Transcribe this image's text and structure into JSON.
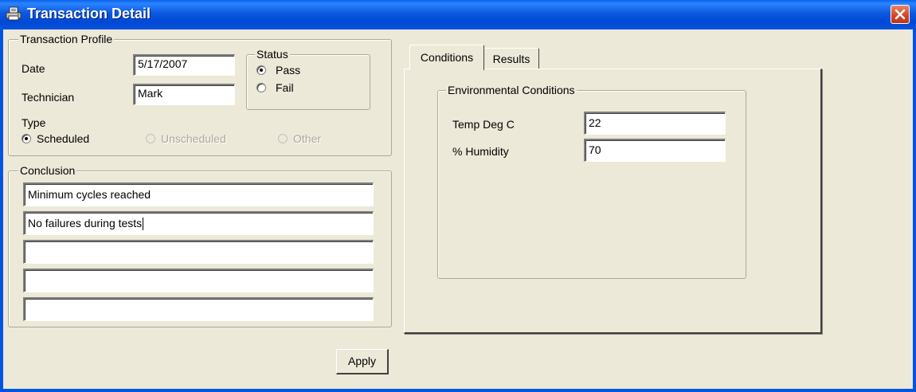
{
  "window": {
    "title": "Transaction Detail",
    "title_icon": "printer-icon",
    "close_icon": "close-icon"
  },
  "profile": {
    "legend": "Transaction Profile",
    "date_label": "Date",
    "date_value": "5/17/2007",
    "technician_label": "Technician",
    "technician_value": "Mark",
    "type_label": "Type",
    "type_options": [
      "Scheduled",
      "Unscheduled",
      "Other"
    ],
    "type_selected": "Scheduled"
  },
  "status": {
    "legend": "Status",
    "options": [
      "Pass",
      "Fail"
    ],
    "selected": "Pass"
  },
  "conclusion": {
    "legend": "Conclusion",
    "lines": [
      "Minimum cycles reached",
      "No failures during tests",
      "",
      "",
      ""
    ]
  },
  "tabs": {
    "items": [
      "Conditions",
      "Results"
    ],
    "active": "Conditions"
  },
  "environment": {
    "legend": "Environmental Conditions",
    "temp_label": "Temp Deg C",
    "temp_value": "22",
    "humidity_label": "% Humidity",
    "humidity_value": "70"
  },
  "apply_label": "Apply"
}
